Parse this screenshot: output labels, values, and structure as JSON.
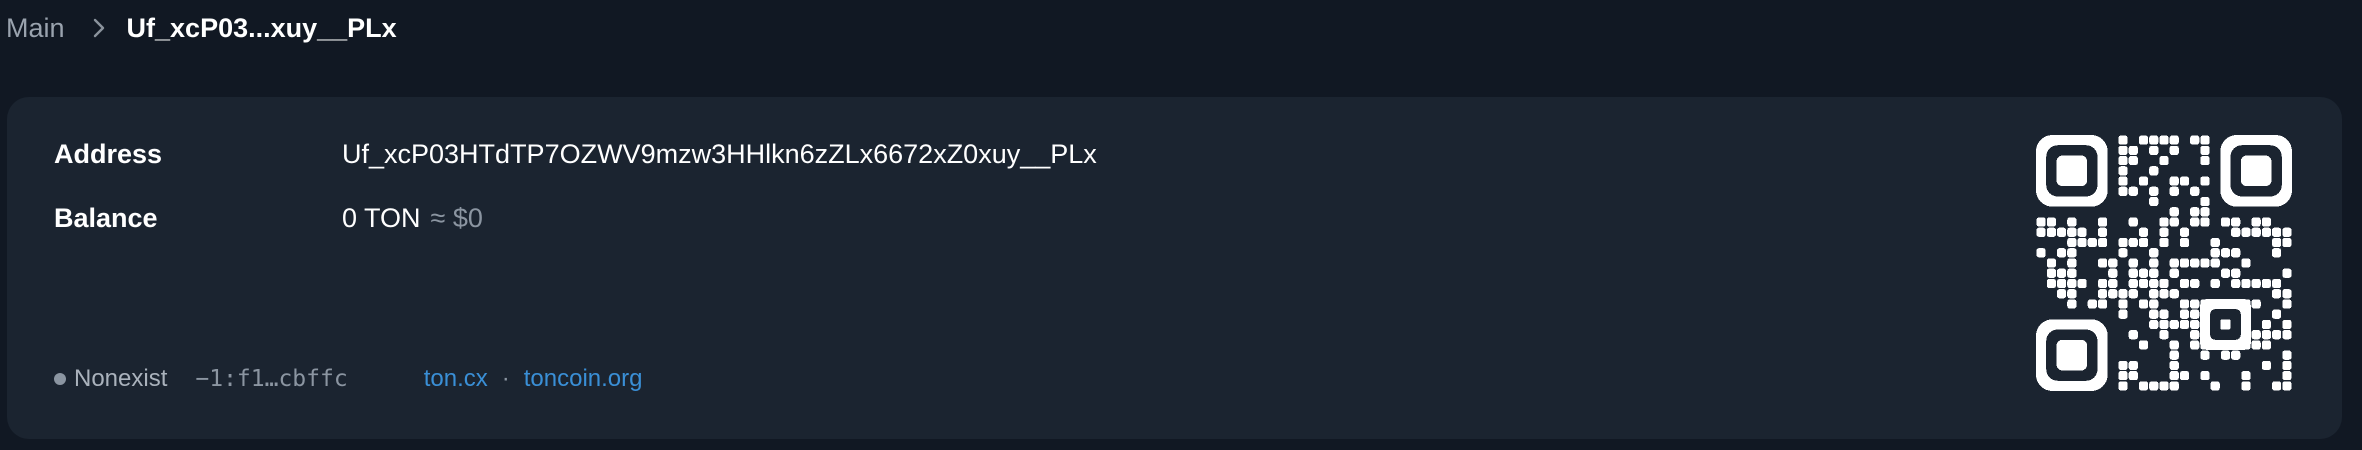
{
  "breadcrumb": {
    "root": "Main",
    "current": "Uf_xcP03...xuy__PLx"
  },
  "account": {
    "address_label": "Address",
    "address_value": "Uf_xcP03HTdTP7OZWV9mzw3HHlkn6zZLx6672xZ0xuy__PLx",
    "balance_label": "Balance",
    "balance_value": "0 TON",
    "balance_fiat": "≈ $0"
  },
  "footer": {
    "status": "Nonexist",
    "raw_address": "−1:f1…cbffc",
    "link1": "ton.cx",
    "separator": "·",
    "link2": "toncoin.org"
  },
  "colors": {
    "background": "#111823",
    "card": "#1b2430",
    "link": "#3a8fd6",
    "muted": "#8b95a1"
  },
  "icons": [
    "chevron-right-icon",
    "qr-code-icon",
    "status-dot-icon"
  ]
}
